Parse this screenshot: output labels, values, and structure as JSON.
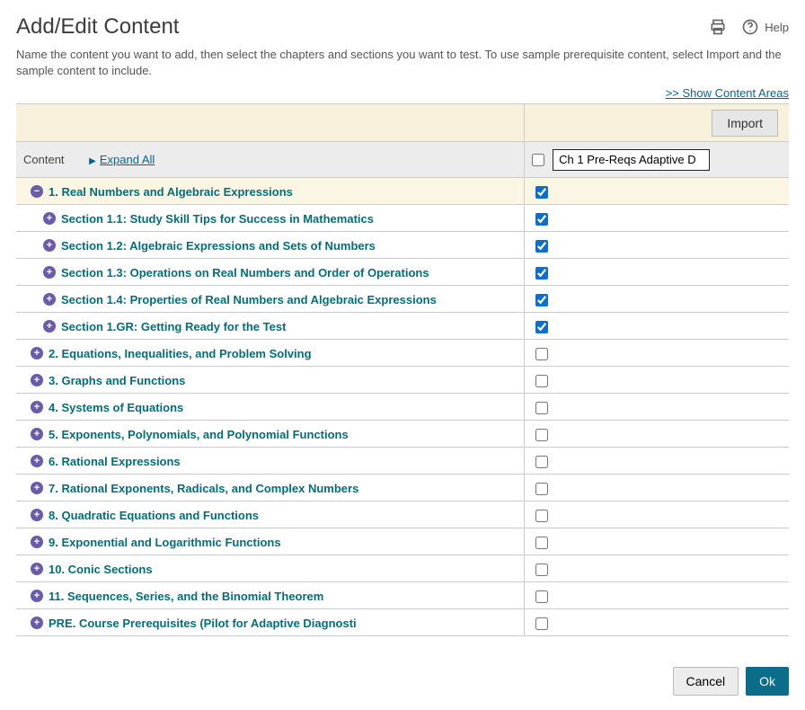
{
  "title": "Add/Edit Content",
  "description": "Name the content you want to add, then select the chapters and sections you want to test. To use sample prerequisite content, select Import and the sample content to include.",
  "header": {
    "help_label": "Help",
    "show_content_areas_label": ">> Show Content Areas",
    "import_button_label": "Import",
    "content_label": "Content",
    "expand_all_label": "Expand All",
    "content_name_value": "Ch 1 Pre-Reqs Adaptive D",
    "header_checkbox_checked": false
  },
  "rows": [
    {
      "indent": 1,
      "expanded": true,
      "label": "1. Real Numbers and Algebraic Expressions",
      "checked": true
    },
    {
      "indent": 2,
      "expanded": false,
      "label": "Section 1.1: Study Skill Tips for Success in Mathematics",
      "checked": true
    },
    {
      "indent": 2,
      "expanded": false,
      "label": "Section 1.2: Algebraic Expressions and Sets of Numbers",
      "checked": true
    },
    {
      "indent": 2,
      "expanded": false,
      "label": "Section 1.3: Operations on Real Numbers and Order of Operations",
      "checked": true
    },
    {
      "indent": 2,
      "expanded": false,
      "label": "Section 1.4: Properties of Real Numbers and Algebraic Expressions",
      "checked": true
    },
    {
      "indent": 2,
      "expanded": false,
      "label": "Section 1.GR: Getting Ready for the Test",
      "checked": true
    },
    {
      "indent": 1,
      "expanded": false,
      "label": "2. Equations, Inequalities, and Problem Solving",
      "checked": false
    },
    {
      "indent": 1,
      "expanded": false,
      "label": "3. Graphs and Functions",
      "checked": false
    },
    {
      "indent": 1,
      "expanded": false,
      "label": "4. Systems of Equations",
      "checked": false
    },
    {
      "indent": 1,
      "expanded": false,
      "label": "5. Exponents, Polynomials, and Polynomial Functions",
      "checked": false
    },
    {
      "indent": 1,
      "expanded": false,
      "label": "6. Rational Expressions",
      "checked": false
    },
    {
      "indent": 1,
      "expanded": false,
      "label": "7. Rational Exponents, Radicals, and Complex Numbers",
      "checked": false
    },
    {
      "indent": 1,
      "expanded": false,
      "label": "8. Quadratic Equations and Functions",
      "checked": false
    },
    {
      "indent": 1,
      "expanded": false,
      "label": "9. Exponential and Logarithmic Functions",
      "checked": false
    },
    {
      "indent": 1,
      "expanded": false,
      "label": "10. Conic Sections",
      "checked": false
    },
    {
      "indent": 1,
      "expanded": false,
      "label": "11. Sequences, Series, and the Binomial Theorem",
      "checked": false
    },
    {
      "indent": 1,
      "expanded": false,
      "label": "PRE. Course Prerequisites (Pilot for Adaptive Diagnosti",
      "checked": false
    }
  ],
  "footer": {
    "cancel_label": "Cancel",
    "ok_label": "Ok"
  }
}
